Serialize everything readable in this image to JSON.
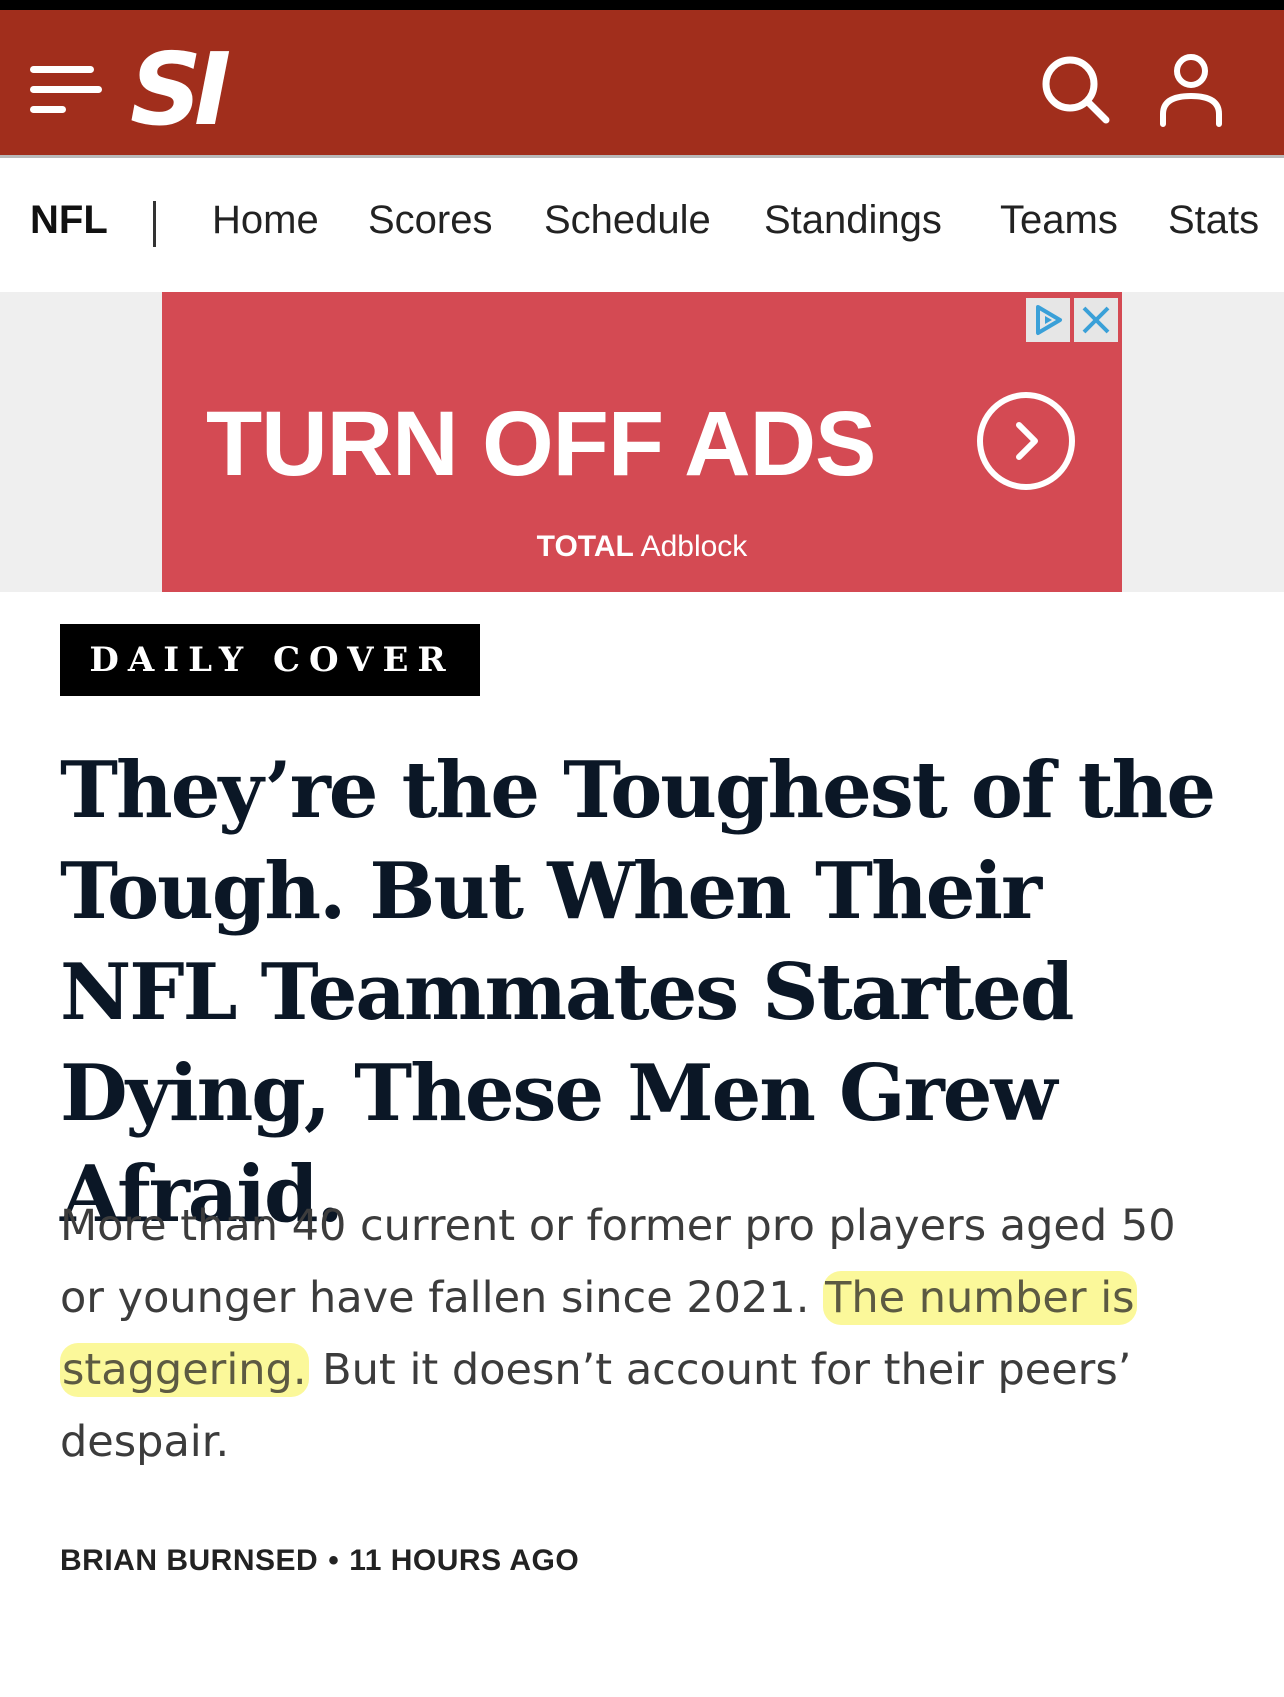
{
  "header": {
    "logo": "SI",
    "menu_icon": "hamburger-menu-icon",
    "search_icon": "search-icon",
    "account_icon": "user-icon",
    "brand_color": "#a12e1c"
  },
  "subnav": {
    "section": "NFL",
    "items": [
      "Home",
      "Scores",
      "Schedule",
      "Standings",
      "Teams",
      "Stats"
    ]
  },
  "ad": {
    "title": "TURN OFF ADS",
    "brand_bold": "TOTAL",
    "brand_rest": "Adblock",
    "background_color": "#d44a53",
    "adchoices_icon": "adchoices-icon",
    "close_icon": "close-icon",
    "arrow_icon": "chevron-right-circle-icon"
  },
  "article": {
    "tag": "DAILY COVER",
    "headline": "They’re the Toughest of the Tough. But When Their NFL Teammates Started Dying, These Men Grew Afraid.",
    "dek_before": "More than 40 current or former pro players aged 50 or younger have fallen since 2021. ",
    "dek_highlight": "The number is staggering.",
    "dek_after": " But it doesn’t account for their peers’ despair.",
    "highlight_color": "#fbf89a",
    "author": "BRIAN BURNSED",
    "byline_separator": "•",
    "time": "11 HOURS AGO"
  }
}
